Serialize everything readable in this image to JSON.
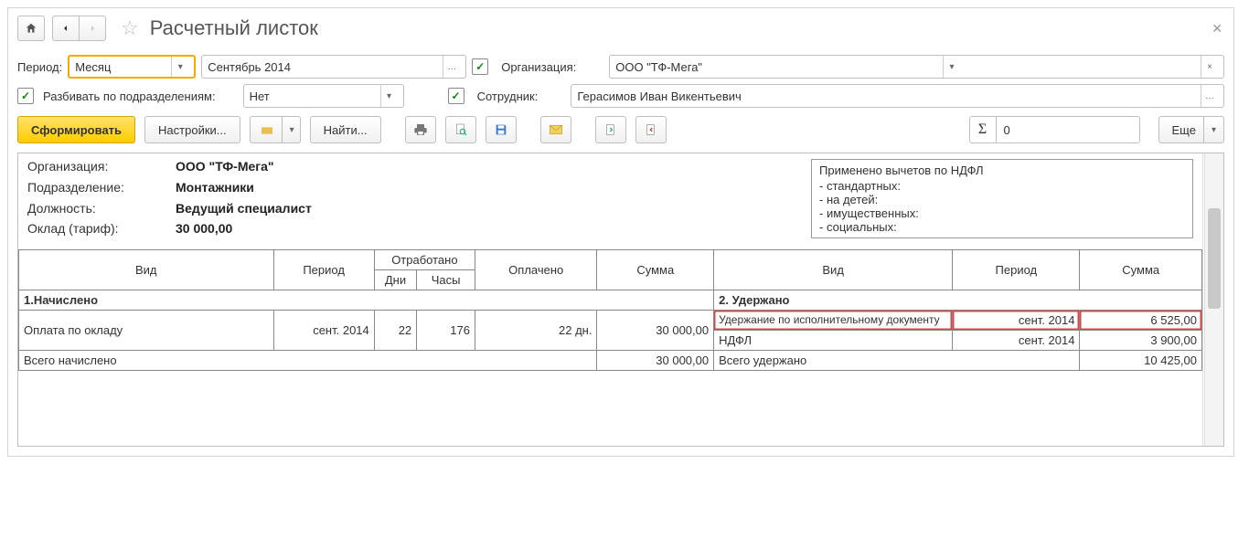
{
  "header": {
    "title": "Расчетный листок"
  },
  "filters": {
    "period_label": "Период:",
    "period_type": "Месяц",
    "period_range": "Сентябрь 2014",
    "org_label": "Организация:",
    "org_value": "ООО \"ТФ-Мега\"",
    "split_label": "Разбивать по подразделениям:",
    "split_value": "Нет",
    "emp_label": "Сотрудник:",
    "emp_value": "Герасимов Иван Викентьевич"
  },
  "toolbar": {
    "generate": "Сформировать",
    "settings": "Настройки...",
    "find": "Найти...",
    "sum_value": "0",
    "more": "Еще"
  },
  "info": {
    "org_k": "Организация:",
    "org_v": "ООО \"ТФ-Мега\"",
    "dept_k": "Подразделение:",
    "dept_v": "Монтажники",
    "pos_k": "Должность:",
    "pos_v": "Ведущий специалист",
    "sal_k": "Оклад (тариф):",
    "sal_v": "30 000,00"
  },
  "deductions_info": {
    "header": "Применено вычетов по НДФЛ",
    "lines": [
      "- стандартных:",
      "- на детей:",
      "- имущественных:",
      "- социальных:"
    ]
  },
  "table": {
    "h_left_type": "Вид",
    "h_period": "Период",
    "h_worked": "Отработано",
    "h_paid": "Оплачено",
    "h_sum": "Сумма",
    "h_days": "Дни",
    "h_hours": "Часы",
    "h_right_type": "Вид",
    "h_right_period": "Период",
    "h_right_sum": "Сумма",
    "section_accrued": "1.Начислено",
    "section_withheld": "2. Удержано",
    "row_accrued_name": "Оплата по окладу",
    "row_accrued_period": "сент. 2014",
    "row_accrued_days": "22",
    "row_accrued_hours": "176",
    "row_accrued_paid": "22 дн.",
    "row_accrued_sum": "30 000,00",
    "row_with1_name": "Удержание по исполнительному документу",
    "row_with1_period": "сент. 2014",
    "row_with1_sum": "6 525,00",
    "row_with2_name": "НДФЛ",
    "row_with2_period": "сент. 2014",
    "row_with2_sum": "3 900,00",
    "total_accrued_label": "Всего начислено",
    "total_accrued_sum": "30 000,00",
    "total_withheld_label": "Всего удержано",
    "total_withheld_sum": "10 425,00"
  }
}
